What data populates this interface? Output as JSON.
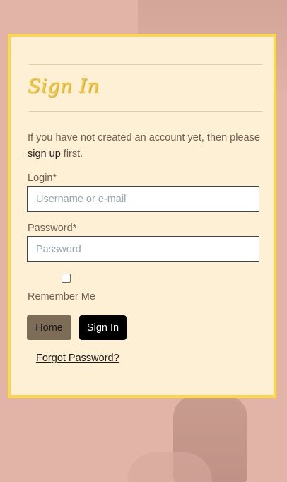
{
  "card": {
    "title": "Sign In",
    "intro_before": "If you have not created an account yet, then please ",
    "signup_link": "sign up",
    "intro_after": " first."
  },
  "form": {
    "login_label": "Login*",
    "login_placeholder": "Username or e-mail",
    "password_label": "Password*",
    "password_placeholder": "Password",
    "remember_label": "Remember Me",
    "remember_checked": false
  },
  "buttons": {
    "home": "Home",
    "signin": "Sign In"
  },
  "forgot_link": "Forgot Password?",
  "colors": {
    "background": "#e2b4a8",
    "card": "#fdf0d5",
    "card_border": "#ffd940",
    "title": "#f2c73a",
    "home_button": "#7d6c58",
    "signin_button": "#000000"
  }
}
